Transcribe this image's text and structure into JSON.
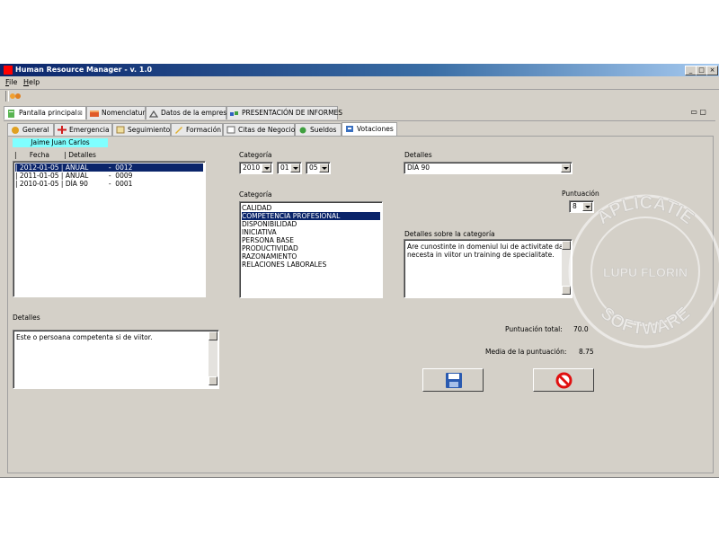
{
  "window": {
    "title": "Human Resource Manager - v. 1.0",
    "controls": [
      "_",
      "□",
      "×"
    ]
  },
  "menubar": {
    "items": [
      "File",
      "Help"
    ]
  },
  "outer_tabs": [
    {
      "label": "Pantalla principal",
      "icon": "document-icon",
      "closable": true,
      "active": true
    },
    {
      "label": "Nomenclatura",
      "icon": "list-icon",
      "active": false
    },
    {
      "label": "Datos de la empresa",
      "icon": "building-icon",
      "active": false
    },
    {
      "label": "PRESENTACIÓN DE INFORMES",
      "icon": "chart-icon",
      "active": false
    }
  ],
  "inner_tabs": [
    {
      "label": "General",
      "icon": "general-icon",
      "active": false
    },
    {
      "label": "Emergencia",
      "icon": "emergency-cross-icon",
      "active": false
    },
    {
      "label": "Seguimiento",
      "icon": "tracking-icon",
      "active": false
    },
    {
      "label": "Formación",
      "icon": "pencil-icon",
      "active": false
    },
    {
      "label": "Citas de Negocios",
      "icon": "calendar-icon",
      "active": false
    },
    {
      "label": "Sueldos",
      "icon": "money-icon",
      "active": false
    },
    {
      "label": "Votaciones",
      "icon": "votes-icon",
      "active": true
    }
  ],
  "employee": {
    "name": "Jaime Juan Carlos"
  },
  "history": {
    "headers": [
      "Fecha",
      "Detalles"
    ],
    "rows": [
      {
        "date": "2012-01-05",
        "type": "ANUAL",
        "num": "0012",
        "selected": true
      },
      {
        "date": "2011-01-05",
        "type": "ANUAL",
        "num": "0009",
        "selected": false
      },
      {
        "date": "2010-01-05",
        "type": "DÍA 90",
        "num": "0001",
        "selected": false
      }
    ]
  },
  "categoria_date": {
    "label": "Categoría",
    "year": "2010",
    "month": "01",
    "day": "05"
  },
  "detalles_top": {
    "label": "Detalles",
    "value": "DÍA 90"
  },
  "categories": {
    "label": "Categoría",
    "items": [
      "CALIDAD",
      "COMPETENCIA PROFESIONAL",
      "DISPONIBILIDAD",
      "INICIATIVA",
      "PERSONA BASE",
      "PRODUCTIVIDAD",
      "RAZONAMIENTO",
      "RELACIONES LABORALES"
    ],
    "selected_index": 1
  },
  "puntuacion": {
    "label": "Puntuación",
    "value": "8"
  },
  "detalles_categoria": {
    "label": "Detalles sobre la categoría",
    "text_line1": "Are cunostinte in domeniul lui de activitate dar",
    "text_line2": "necesta in viitor un training de specialitate."
  },
  "detalles_bottom": {
    "label": "Detalles",
    "text": "Este o persoana competenta si de viitor."
  },
  "totals": {
    "total_label": "Puntuación total:",
    "total_value": "70.0",
    "media_label": "Media de la puntuación:",
    "media_value": "8.75"
  },
  "buttons": {
    "save_icon": "floppy-disk-icon",
    "cancel_icon": "no-entry-icon"
  },
  "watermark": {
    "top": "APLICATIE",
    "middle": "LUPU FLORIN",
    "bottom": "SOFTWARE"
  },
  "colors": {
    "title_bar": "#0a246a",
    "selection": "#0a246a",
    "person_highlight": "#7fffff",
    "cancel_red": "#e01010"
  }
}
